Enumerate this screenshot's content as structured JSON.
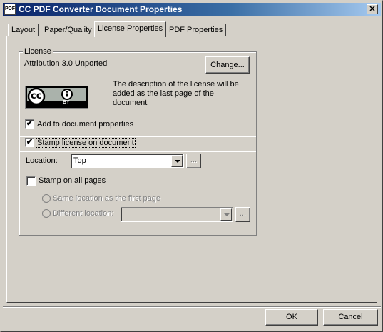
{
  "window": {
    "title": "CC PDF Converter Document Properties",
    "app_icon_text": "PDF",
    "close_label": "✕"
  },
  "tabs": [
    {
      "label": "Layout"
    },
    {
      "label": "Paper/Quality"
    },
    {
      "label": "License Properties"
    },
    {
      "label": "PDF Properties"
    }
  ],
  "license": {
    "group_label": "License",
    "name": "Attribution 3.0 Unported",
    "change_button": "Change...",
    "description": "The description of the license will be added as the last page of the document",
    "logo_cc": "cc",
    "logo_by": "BY",
    "add_to_properties_label": "Add to document properties",
    "add_to_properties_checked": true
  },
  "stamp": {
    "stamp_label": "Stamp license on document",
    "stamp_checked": true,
    "location_label": "Location:",
    "location_value": "Top",
    "ellipsis": "...",
    "all_pages_label": "Stamp on all pages",
    "all_pages_checked": false,
    "same_location_label": "Same location as the first page",
    "different_location_label": "Different location:",
    "different_location_value": ""
  },
  "footer": {
    "ok": "OK",
    "cancel": "Cancel"
  },
  "check_mark": "✔"
}
